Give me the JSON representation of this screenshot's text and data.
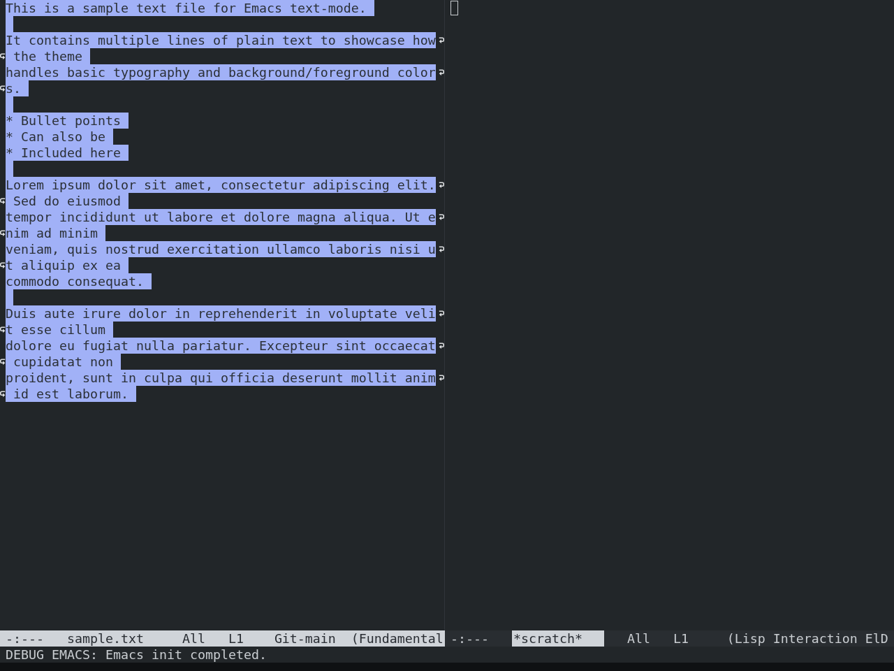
{
  "windows": [
    {
      "lines": [
        {
          "kind": "text",
          "text": "This is a sample text file for Emacs text-mode.",
          "selected": true,
          "wrapped": false,
          "continued": false
        },
        {
          "kind": "blank",
          "selected": true,
          "wrapped": false,
          "continued": false
        },
        {
          "kind": "text",
          "text": "It contains multiple lines of plain text to showcase how",
          "selected": true,
          "wrapped": true,
          "continued": false
        },
        {
          "kind": "text",
          "text": " the theme",
          "selected": true,
          "wrapped": false,
          "continued": true
        },
        {
          "kind": "text",
          "text": "handles basic typography and background/foreground color",
          "selected": true,
          "wrapped": true,
          "continued": false
        },
        {
          "kind": "text",
          "text": "s.",
          "selected": true,
          "wrapped": false,
          "continued": true
        },
        {
          "kind": "blank",
          "selected": true,
          "wrapped": false,
          "continued": false
        },
        {
          "kind": "text",
          "text": "* Bullet points",
          "selected": true,
          "wrapped": false,
          "continued": false
        },
        {
          "kind": "text",
          "text": "* Can also be",
          "selected": true,
          "wrapped": false,
          "continued": false
        },
        {
          "kind": "text",
          "text": "* Included here",
          "selected": true,
          "wrapped": false,
          "continued": false
        },
        {
          "kind": "blank",
          "selected": true,
          "wrapped": false,
          "continued": false
        },
        {
          "kind": "text",
          "text": "Lorem ipsum dolor sit amet, consectetur adipiscing elit.",
          "selected": true,
          "wrapped": true,
          "continued": false
        },
        {
          "kind": "text",
          "text": " Sed do eiusmod",
          "selected": true,
          "wrapped": false,
          "continued": true
        },
        {
          "kind": "text",
          "text": "tempor incididunt ut labore et dolore magna aliqua. Ut e",
          "selected": true,
          "wrapped": true,
          "continued": false
        },
        {
          "kind": "text",
          "text": "nim ad minim",
          "selected": true,
          "wrapped": false,
          "continued": true
        },
        {
          "kind": "text",
          "text": "veniam, quis nostrud exercitation ullamco laboris nisi u",
          "selected": true,
          "wrapped": true,
          "continued": false
        },
        {
          "kind": "text",
          "text": "t aliquip ex ea",
          "selected": true,
          "wrapped": false,
          "continued": true
        },
        {
          "kind": "text",
          "text": "commodo consequat.",
          "selected": true,
          "wrapped": false,
          "continued": false
        },
        {
          "kind": "blank",
          "selected": true,
          "wrapped": false,
          "continued": false
        },
        {
          "kind": "text",
          "text": "Duis aute irure dolor in reprehenderit in voluptate veli",
          "selected": true,
          "wrapped": true,
          "continued": false
        },
        {
          "kind": "text",
          "text": "t esse cillum",
          "selected": true,
          "wrapped": false,
          "continued": true
        },
        {
          "kind": "text",
          "text": "dolore eu fugiat nulla pariatur. Excepteur sint occaecat",
          "selected": true,
          "wrapped": true,
          "continued": false
        },
        {
          "kind": "text",
          "text": " cupidatat non",
          "selected": true,
          "wrapped": false,
          "continued": true
        },
        {
          "kind": "text",
          "text": "proident, sunt in culpa qui officia deserunt mollit anim",
          "selected": true,
          "wrapped": true,
          "continued": false
        },
        {
          "kind": "text",
          "text": " id est laborum.",
          "selected": true,
          "wrapped": false,
          "continued": true
        }
      ],
      "mode_line": {
        "active": true,
        "status": "-:---",
        "buffer": "sample.txt",
        "position": "All",
        "line": "L1",
        "vc": "Git-main",
        "mode": "(Fundamental"
      }
    },
    {
      "cursor_visible": true,
      "mode_line": {
        "active": false,
        "status": "-:---",
        "buffer": "*scratch*",
        "position": "All",
        "line": "L1",
        "mode": "(Lisp Interaction ElD"
      }
    }
  ],
  "echo_area": "DEBUG EMACS: Emacs init completed."
}
